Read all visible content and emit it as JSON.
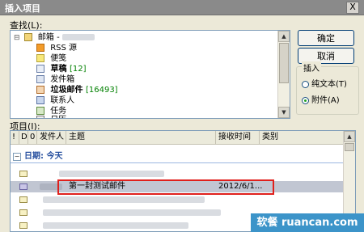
{
  "window": {
    "title": "插入项目",
    "close_glyph": "X"
  },
  "lookin": {
    "label": "查找(L):",
    "tree": [
      {
        "label": "邮箱 - ",
        "icon": "mailbox-icon",
        "bold": false,
        "count": "",
        "blurred": true
      },
      {
        "label": "RSS 源",
        "icon": "rss-icon",
        "bold": false,
        "count": ""
      },
      {
        "label": "便笺",
        "icon": "notes-icon",
        "bold": false,
        "count": ""
      },
      {
        "label": "草稿",
        "icon": "drafts-icon",
        "bold": true,
        "count": "[12]"
      },
      {
        "label": "发件箱",
        "icon": "outbox-icon",
        "bold": false,
        "count": ""
      },
      {
        "label": "垃圾邮件",
        "icon": "junk-icon",
        "bold": true,
        "count": "[16493]"
      },
      {
        "label": "联系人",
        "icon": "contacts-icon",
        "bold": false,
        "count": ""
      },
      {
        "label": "任务",
        "icon": "tasks-icon",
        "bold": false,
        "count": ""
      },
      {
        "label": "日历",
        "icon": "calendar-icon",
        "bold": false,
        "count": ""
      }
    ]
  },
  "buttons": {
    "ok": "确定",
    "cancel": "取消"
  },
  "insert_as": {
    "label": "插入",
    "options": [
      {
        "label": "纯文本(T)",
        "checked": false
      },
      {
        "label": "附件(A)",
        "checked": true
      }
    ]
  },
  "items": {
    "label": "项目(I):",
    "columns": [
      "!",
      "D",
      "0",
      "发件人",
      "主题",
      "接收时间",
      "类别"
    ],
    "group_label": "日期: 今天",
    "rows": [
      {
        "sender": "",
        "subject": "",
        "received": "",
        "selected": false
      },
      {
        "sender": "",
        "subject": "第一封测试邮件",
        "received": "2012/6/1...",
        "selected": true
      },
      {
        "sender": "",
        "subject": "",
        "received": "",
        "selected": false
      },
      {
        "sender": "",
        "subject": "",
        "received": "",
        "selected": false
      },
      {
        "sender": "",
        "subject": "",
        "received": "",
        "selected": false
      }
    ]
  },
  "watermark": "软餐 ruancan.com"
}
